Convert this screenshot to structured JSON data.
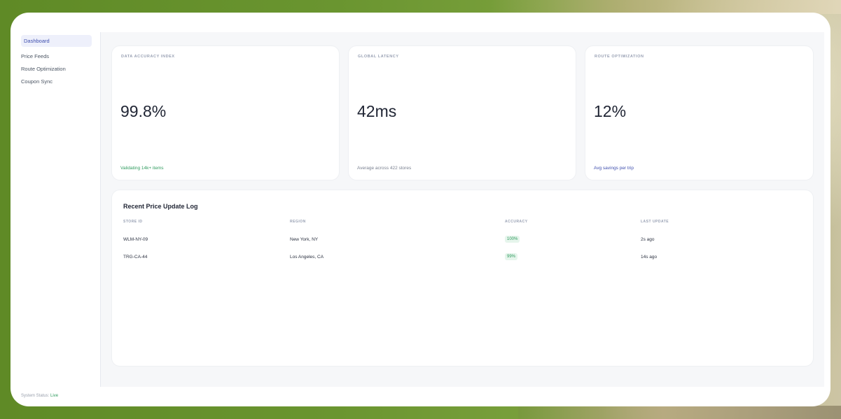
{
  "sidebar": {
    "items": [
      {
        "label": "Dashboard",
        "active": true
      },
      {
        "label": "Price Feeds",
        "active": false
      },
      {
        "label": "Route Optimization",
        "active": false
      },
      {
        "label": "Coupon Sync",
        "active": false
      }
    ],
    "status_label": "System Status:",
    "status_value": "Live"
  },
  "metrics": [
    {
      "label": "DATA ACCURACY INDEX",
      "value": "99.8%",
      "sub": "Validating 14k+ items",
      "sub_color": "#2f9b5e"
    },
    {
      "label": "GLOBAL LATENCY",
      "value": "42ms",
      "sub": "Average across 422 stores",
      "sub_color": "#7a8190"
    },
    {
      "label": "ROUTE OPTIMIZATION",
      "value": "12%",
      "sub": "Avg savings per trip",
      "sub_color": "#3f4fae"
    }
  ],
  "log": {
    "title": "Recent Price Update Log",
    "columns": [
      "STORE ID",
      "REGION",
      "ACCURACY",
      "LAST UPDATE"
    ],
    "rows": [
      {
        "store": "WLM-NY-09",
        "region": "New York, NY",
        "accuracy": "100%",
        "updated": "2s ago"
      },
      {
        "store": "TRG-CA-44",
        "region": "Los Angeles, CA",
        "accuracy": "99%",
        "updated": "14s ago"
      }
    ]
  },
  "colors": {
    "accent": "#3f4fae",
    "success": "#2f9b5e",
    "background": "#f6f7f9"
  }
}
